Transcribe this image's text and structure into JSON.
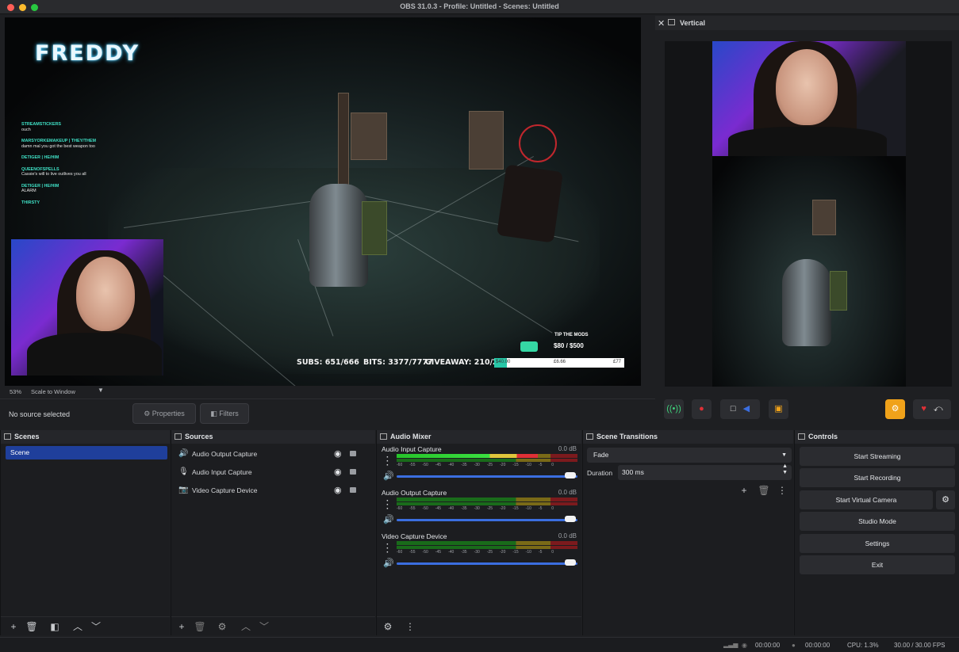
{
  "window": {
    "title": "OBS 31.0.3 - Profile: Untitled - Scenes: Untitled"
  },
  "preview": {
    "overlay_title": "FREDDY",
    "chat": [
      {
        "name": "STREAMSTICKERS",
        "msg": "ouch"
      },
      {
        "name": "MARSYORKEMAKEUP | THEY/THEM",
        "msg": "damn mal you got the best weapon too"
      },
      {
        "name": "DETIGER | HE/HIM",
        "msg": ""
      },
      {
        "name": "QUEENOFSPELLS",
        "msg": "Cassie's will to live outlives you all"
      },
      {
        "name": "DETIGER | HE/HIM",
        "msg": "ALARM"
      },
      {
        "name": "THIRSTY",
        "msg": ""
      }
    ],
    "subs": "SUBS: 651/666",
    "bits": "BITS: 3377/7777",
    "giveaway": "GIVEAWAY: 210/25",
    "tip_label": "TIP THE MODS",
    "tip_amount": "$80 / $500",
    "goal_left": "$40.00",
    "goal_mid": "£6.66",
    "goal_right": "£77",
    "zoom": "53%",
    "scale_mode": "Scale to Window"
  },
  "source_toolbar": {
    "no_source": "No source selected",
    "properties": "Properties",
    "filters": "Filters"
  },
  "vertical": {
    "title": "Vertical"
  },
  "docks": {
    "scenes": {
      "title": "Scenes",
      "items": [
        "Scene"
      ]
    },
    "sources": {
      "title": "Sources",
      "items": [
        {
          "label": "Audio Output Capture",
          "icon": "speaker-icon"
        },
        {
          "label": "Audio Input Capture",
          "icon": "microphone-icon"
        },
        {
          "label": "Video Capture Device",
          "icon": "camera-icon"
        }
      ]
    },
    "mixer": {
      "title": "Audio Mixer",
      "ticks": [
        "-60",
        "-55",
        "-50",
        "-45",
        "-40",
        "-35",
        "-30",
        "-25",
        "-20",
        "-15",
        "-10",
        "-5",
        "0"
      ],
      "channels": [
        {
          "name": "Audio Input Capture",
          "db": "0.0 dB",
          "level": 0.78
        },
        {
          "name": "Audio Output Capture",
          "db": "0.0 dB",
          "level": 0.0
        },
        {
          "name": "Video Capture Device",
          "db": "0.0 dB",
          "level": 0.0
        }
      ]
    },
    "transitions": {
      "title": "Scene Transitions",
      "type": "Fade",
      "duration_label": "Duration",
      "duration": "300 ms"
    },
    "controls": {
      "title": "Controls",
      "start_streaming": "Start Streaming",
      "start_recording": "Start Recording",
      "start_virtual_camera": "Start Virtual Camera",
      "studio_mode": "Studio Mode",
      "settings": "Settings",
      "exit": "Exit"
    }
  },
  "status": {
    "stream_time": "00:00:00",
    "rec_time": "00:00:00",
    "cpu": "CPU: 1.3%",
    "fps": "30.00 / 30.00 FPS"
  },
  "colors": {
    "accent": "#1f3f9b",
    "meter_green": "#26c42a",
    "meter_yellow": "#e0c63c",
    "meter_red": "#e03036"
  }
}
